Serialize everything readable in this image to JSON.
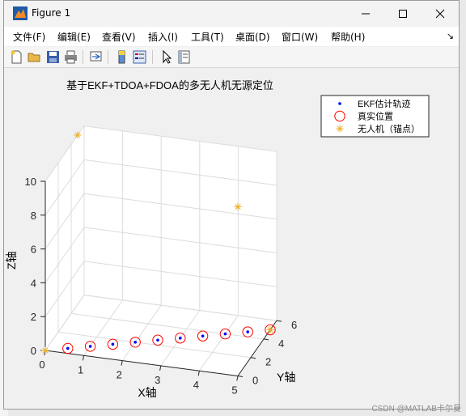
{
  "window": {
    "title": "Figure 1"
  },
  "menu": [
    {
      "label": "文件(F)"
    },
    {
      "label": "编辑(E)"
    },
    {
      "label": "查看(V)"
    },
    {
      "label": "插入(I)"
    },
    {
      "label": "工具(T)"
    },
    {
      "label": "桌面(D)"
    },
    {
      "label": "窗口(W)"
    },
    {
      "label": "帮助(H)"
    }
  ],
  "toolbar_icons": [
    "new-figure-icon",
    "open-file-icon",
    "save-icon",
    "print-icon",
    "link-icon",
    "colorbar-icon",
    "legend-icon",
    "pointer-icon",
    "property-inspector-icon"
  ],
  "watermark": "CSDN @MATLAB卡尔曼",
  "chart_data": {
    "type": "scatter",
    "projection": "3d",
    "title": "基于EKF+TDOA+FDOA的多无人机无源定位",
    "xlabel": "X轴",
    "ylabel": "Y轴",
    "zlabel": "Z轴",
    "xlim": [
      0,
      5
    ],
    "ylim": [
      0,
      6
    ],
    "zlim": [
      0,
      10
    ],
    "xticks": [
      "0",
      "1",
      "2",
      "3",
      "4",
      "5"
    ],
    "yticks": [
      "0",
      "2",
      "4",
      "6"
    ],
    "zticks": [
      "0",
      "2",
      "4",
      "6",
      "8",
      "10"
    ],
    "grid": true,
    "legend_position": "top-right",
    "series": [
      {
        "name": "EKF估计轨迹",
        "marker": "dot",
        "color": "#0000ff",
        "points": [
          [
            0.5,
            0.5,
            0
          ],
          [
            1,
            1,
            0
          ],
          [
            1.5,
            1.5,
            0
          ],
          [
            2,
            2,
            0
          ],
          [
            2.5,
            2.5,
            0
          ],
          [
            3,
            3,
            0
          ],
          [
            3.5,
            3.5,
            0
          ],
          [
            4,
            4,
            0
          ],
          [
            4.5,
            4.5,
            0
          ],
          [
            5,
            5,
            0
          ]
        ]
      },
      {
        "name": "真实位置",
        "marker": "circle",
        "color": "#ff0000",
        "points": [
          [
            0.5,
            0.5,
            0
          ],
          [
            1,
            1,
            0
          ],
          [
            1.5,
            1.5,
            0
          ],
          [
            2,
            2,
            0
          ],
          [
            2.5,
            2.5,
            0
          ],
          [
            3,
            3,
            0
          ],
          [
            3.5,
            3.5,
            0
          ],
          [
            4,
            4,
            0
          ],
          [
            4.5,
            4.5,
            0
          ],
          [
            5,
            5,
            0
          ]
        ]
      },
      {
        "name": "无人机（锚点）",
        "marker": "star",
        "color": "#edb120",
        "points": [
          [
            0,
            0,
            0
          ],
          [
            5,
            5,
            0
          ],
          [
            0,
            5,
            10
          ],
          [
            5,
            0,
            10
          ]
        ]
      }
    ]
  }
}
